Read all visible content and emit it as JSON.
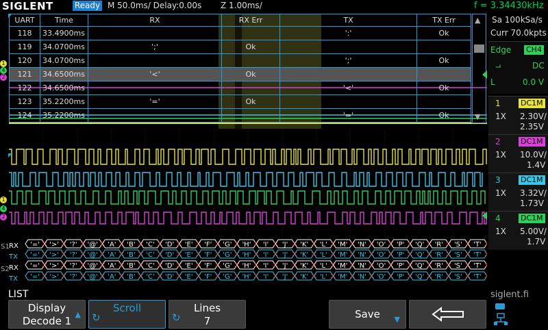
{
  "topbar": {
    "logo": "SIGLENT",
    "run_status": "Ready",
    "timebase": "M 50.0ms/ Delay:0.00s",
    "zoom": "Z 1.00ms/",
    "frequency": "f = 3.34430kHz"
  },
  "acquisition": {
    "sample_rate": "Sa 100kSa/s",
    "memory": "Curr 70.0kpts"
  },
  "trigger": {
    "type": "Edge",
    "source": "CH4",
    "coupling": "DC",
    "mode": "L",
    "level": "0.0 V"
  },
  "channels": [
    {
      "num": "1",
      "coupling": "DC1M",
      "probe": "1X",
      "scale": "2.30V/",
      "offset": "2.35V",
      "color": "#e8e23a"
    },
    {
      "num": "2",
      "coupling": "DC1M",
      "probe": "1X",
      "scale": "10.0V/",
      "offset": "1.4V",
      "color": "#d940d6"
    },
    {
      "num": "3",
      "coupling": "DC1M",
      "probe": "1X",
      "scale": "3.32V/",
      "offset": "1.73V",
      "color": "#3ac6e6"
    },
    {
      "num": "4",
      "coupling": "DC1M",
      "probe": "1X",
      "scale": "5.00V/",
      "offset": "1.7V",
      "color": "#2fd05a"
    }
  ],
  "decode_list": {
    "headers": [
      "UART",
      "Time",
      "RX",
      "RX Err",
      "TX",
      "TX Err"
    ],
    "rows": [
      {
        "idx": "118",
        "time": "33.4900ms",
        "rx": "",
        "rx_err": "",
        "tx": "':'",
        "tx_err": "Ok"
      },
      {
        "idx": "119",
        "time": "34.0700ms",
        "rx": "';'",
        "rx_err": "Ok",
        "tx": "",
        "tx_err": ""
      },
      {
        "idx": "120",
        "time": "34.0700ms",
        "rx": "",
        "rx_err": "",
        "tx": "';'",
        "tx_err": "Ok"
      },
      {
        "idx": "121",
        "time": "34.6500ms",
        "rx": "'<'",
        "rx_err": "Ok",
        "tx": "",
        "tx_err": ""
      },
      {
        "idx": "122",
        "time": "34.6500ms",
        "rx": "",
        "rx_err": "",
        "tx": "'<'",
        "tx_err": "Ok"
      },
      {
        "idx": "123",
        "time": "35.2200ms",
        "rx": "'='",
        "rx_err": "Ok",
        "tx": "",
        "tx_err": ""
      },
      {
        "idx": "124",
        "time": "35.2200ms",
        "rx": "",
        "rx_err": "",
        "tx": "'='",
        "tx_err": "Ok"
      }
    ],
    "selected_row": 3
  },
  "bus_decode": {
    "bus1_label": "S1",
    "bus2_label": "S2",
    "rx_label": "RX",
    "tx_label": "TX",
    "symbols": [
      "'='",
      "'>'",
      "'?'",
      "'@'",
      "'A'",
      "'B'",
      "'C'",
      "'D'",
      "'E'",
      "'F'",
      "'G'",
      "'H'",
      "'I'",
      "'J'",
      "'K'",
      "'L'",
      "'M'",
      "'N'",
      "'O'",
      "'P'",
      "'Q'",
      "'R'",
      "'S'",
      "'T'"
    ]
  },
  "menu": {
    "title": "LIST",
    "display_line1": "Display",
    "display_line2": "Decode 1",
    "scroll": "Scroll",
    "lines_line1": "Lines",
    "lines_value": "7",
    "save": "Save",
    "site": "siglent.fi"
  },
  "colors": {
    "accent": "#2a9bd6",
    "ch1": "#e8e23a",
    "ch2": "#d940d6",
    "ch3": "#3ac6e6",
    "ch4": "#2fd05a",
    "decode_rx": "#ffffff",
    "decode_tx": "#3ac6e6"
  }
}
